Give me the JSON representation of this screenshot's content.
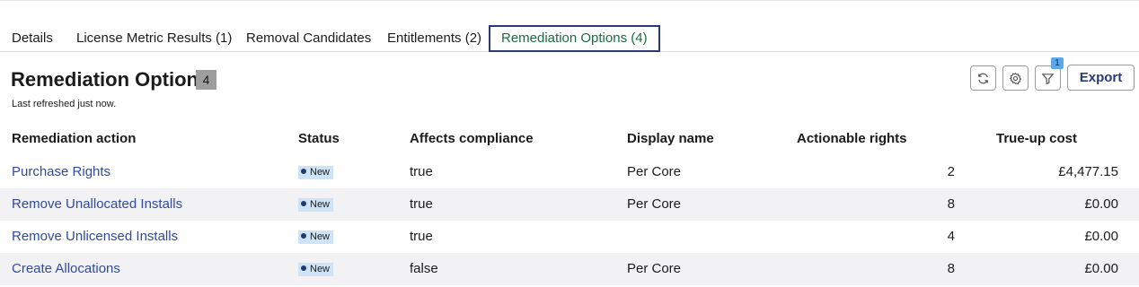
{
  "tabs": [
    {
      "label": "Details"
    },
    {
      "label": "License Metric Results (1)"
    },
    {
      "label": "Removal Candidates"
    },
    {
      "label": "Entitlements (2)"
    },
    {
      "label": "Remediation Options (4)",
      "active": true
    }
  ],
  "header": {
    "title": "Remediation Options",
    "count": "4",
    "refreshed": "Last refreshed just now."
  },
  "toolbar": {
    "refresh_icon": "refresh-icon",
    "settings_icon": "gear-icon",
    "filter_icon": "filter-icon",
    "filter_count": "1",
    "export_label": "Export"
  },
  "table": {
    "columns": [
      "Remediation action",
      "Status",
      "Affects compliance",
      "Display name",
      "Actionable rights",
      "True-up cost"
    ],
    "rows": [
      {
        "action": "Purchase Rights",
        "status": "New",
        "affects": "true",
        "display": "Per Core",
        "rights": "2",
        "cost": "£4,477.15"
      },
      {
        "action": "Remove Unallocated Installs",
        "status": "New",
        "affects": "true",
        "display": "Per Core",
        "rights": "8",
        "cost": "£0.00"
      },
      {
        "action": "Remove Unlicensed Installs",
        "status": "New",
        "affects": "true",
        "display": "",
        "rights": "4",
        "cost": "£0.00"
      },
      {
        "action": "Create Allocations",
        "status": "New",
        "affects": "false",
        "display": "Per Core",
        "rights": "8",
        "cost": "£0.00"
      }
    ]
  },
  "colors": {
    "link": "#2f4a9e",
    "active_tab_text": "#1d6b3f",
    "active_tab_border": "#2a3a78",
    "status_badge_bg": "#cfe3f7",
    "alt_row_bg": "#f2f2f4"
  }
}
